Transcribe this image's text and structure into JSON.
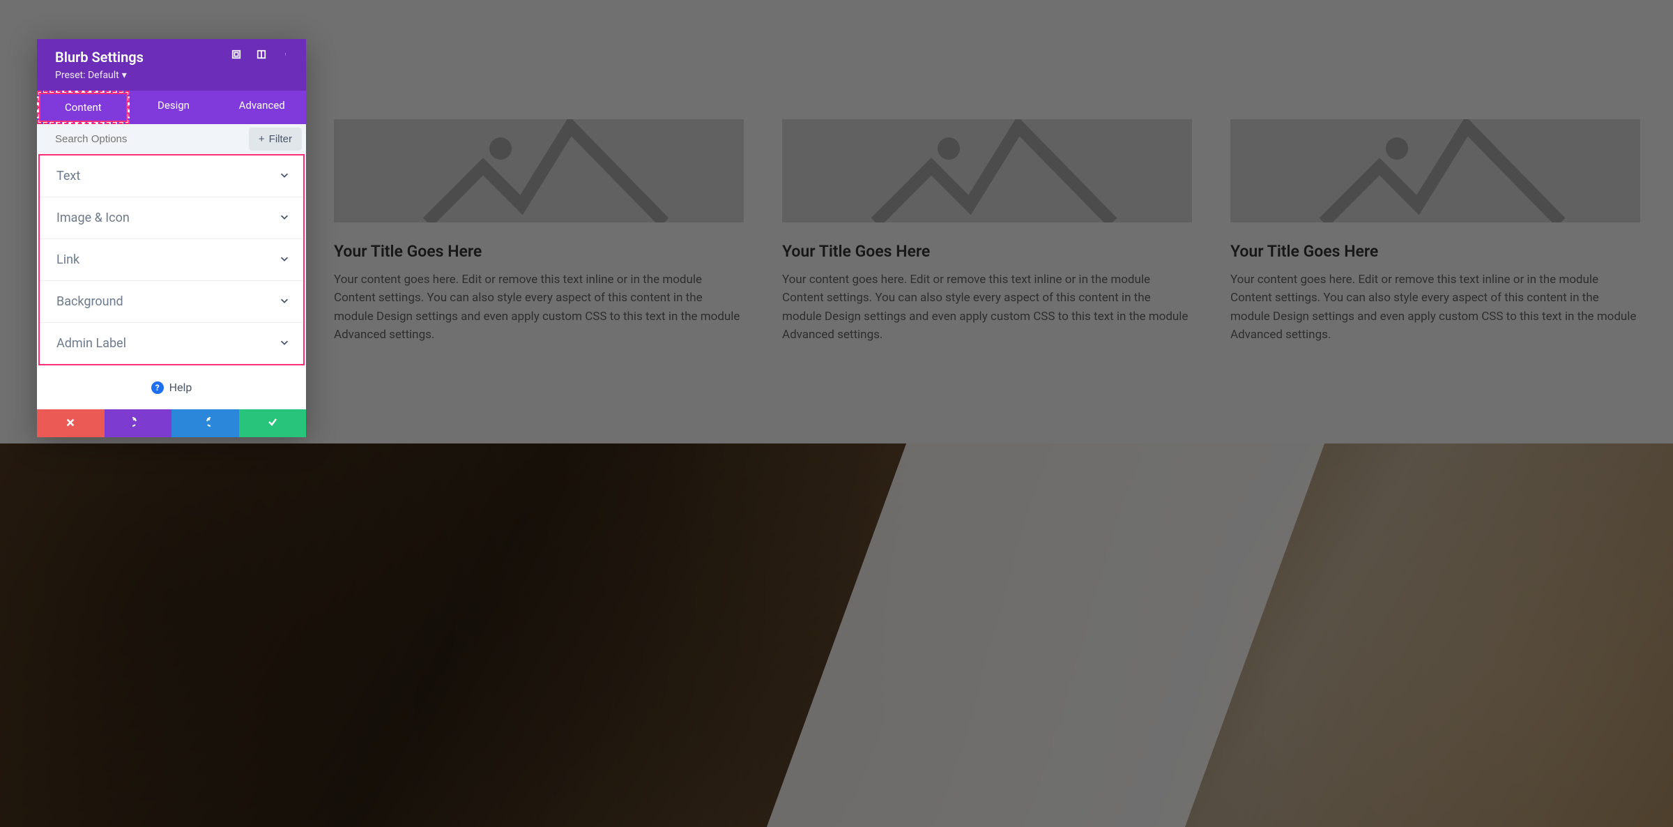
{
  "panel": {
    "title": "Blurb Settings",
    "preset": "Preset: Default",
    "tabs": [
      "Content",
      "Design",
      "Advanced"
    ],
    "activeTab": 0,
    "search_placeholder": "Search Options",
    "filter_label": "Filter",
    "sections": [
      "Text",
      "Image & Icon",
      "Link",
      "Background",
      "Admin Label"
    ],
    "help_label": "Help"
  },
  "blurbs": {
    "title": "Your Title Goes Here",
    "text": "Your content goes here. Edit or remove this text inline or in the module Content settings. You can also style every aspect of this content in the module Design settings and even apply custom CSS to this text in the module Advanced settings."
  }
}
